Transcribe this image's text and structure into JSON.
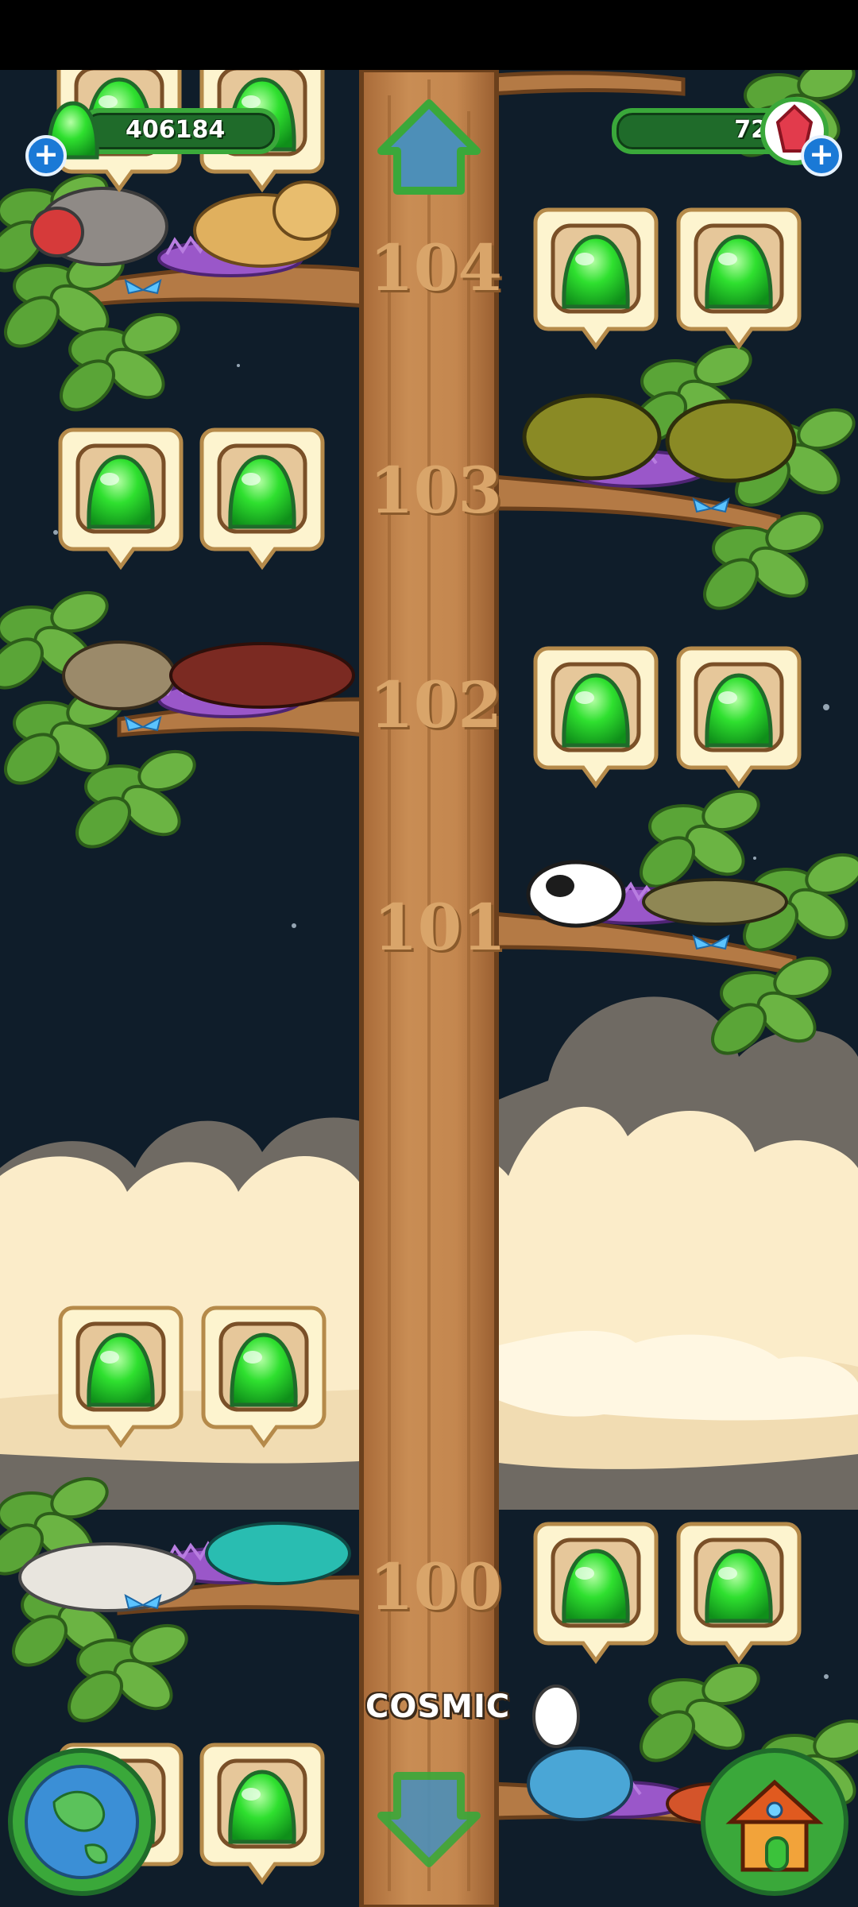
{
  "hud": {
    "currency_value": "406184",
    "gem_value": "72",
    "currency_plus": "+",
    "gem_plus": "+"
  },
  "floors": [
    "104",
    "103",
    "102",
    "101",
    "100"
  ],
  "zone_label": "COSMIC",
  "icons": {
    "up": "up-arrow-icon",
    "down": "down-arrow-icon",
    "globe": "globe-icon",
    "home": "house-icon",
    "gem": "red-gem-icon",
    "jelly": "green-jelly-icon"
  },
  "colors": {
    "sky": "#0f1d2a",
    "trunk": "#c4874f",
    "leaf": "#5aa537",
    "hud_green": "#3aa83a",
    "bubble_bg": "#fdf4cf",
    "jelly": "#2fe02f"
  }
}
